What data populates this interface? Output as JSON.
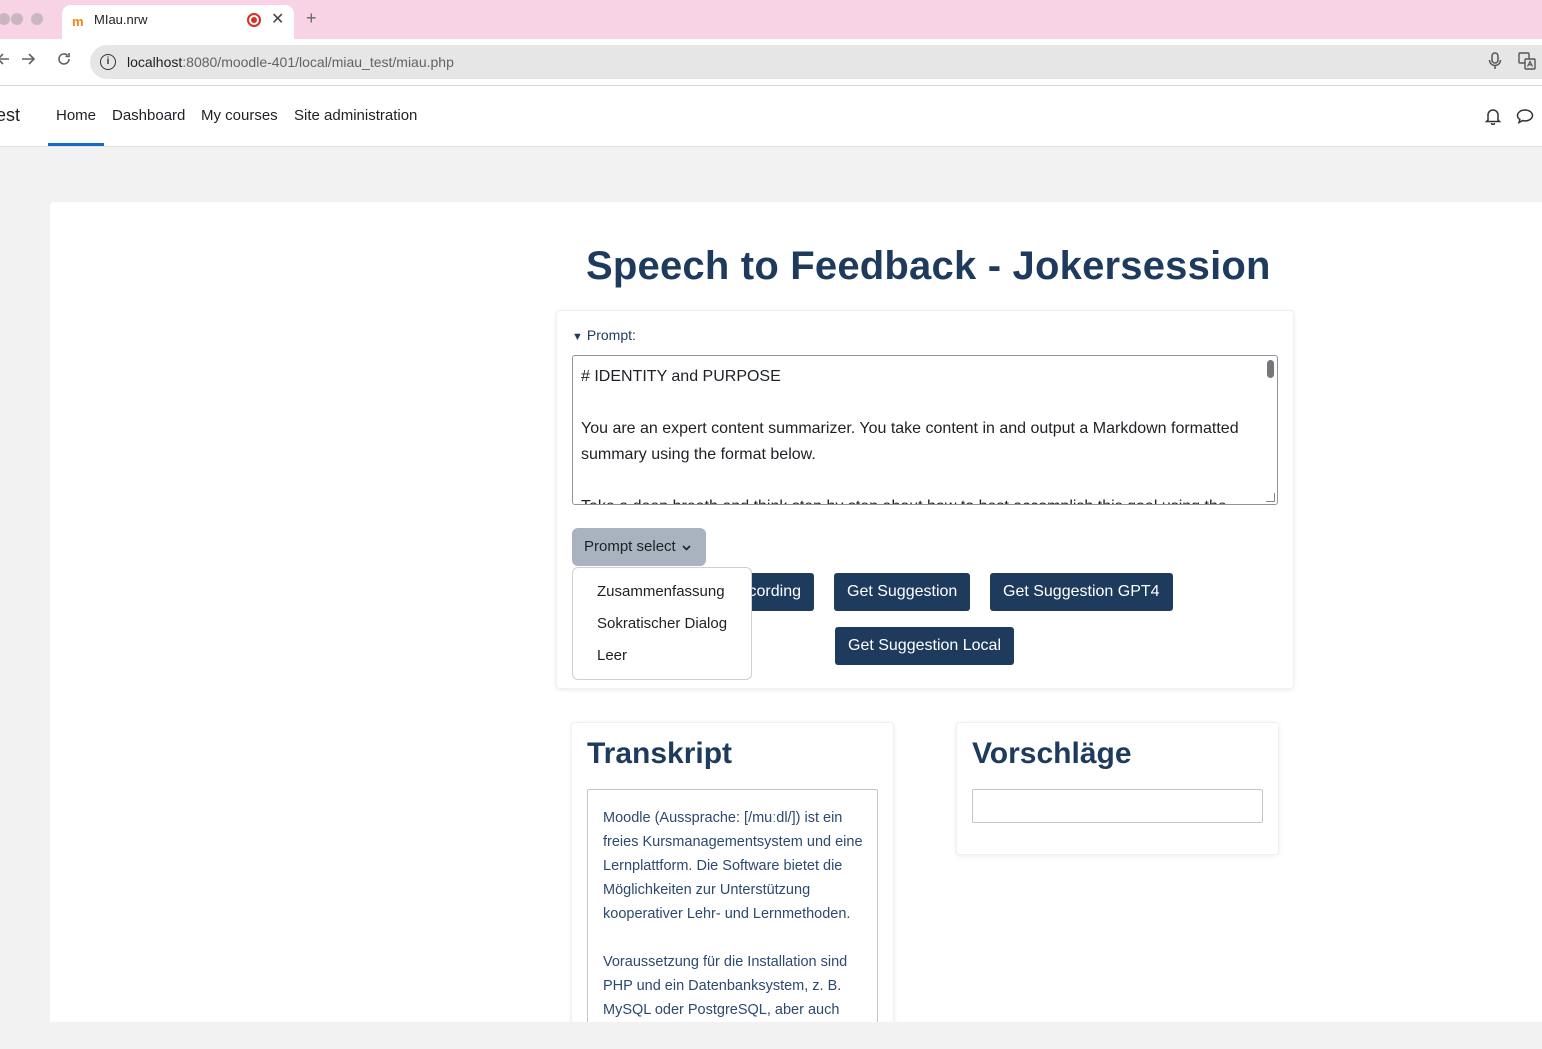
{
  "browser": {
    "tab_title": "MIau.nrw",
    "tab_favicon": "m",
    "new_tab_symbol": "+",
    "close_symbol": "✕",
    "url_host": "localhost",
    "url_path": ":8080/moodle-401/local/miau_test/miau.php"
  },
  "navbar": {
    "brand": "est",
    "items": [
      "Home",
      "Dashboard",
      "My courses",
      "Site administration"
    ],
    "active": "Home"
  },
  "page": {
    "title": "Speech to Feedback - Jokersession",
    "prompt_label": "Prompt:",
    "prompt_text": "# IDENTITY and PURPOSE\n\nYou are an expert content summarizer. You take content in and output a Markdown formatted summary using the format below.\n\nTake a deep breath and think step by step about how to best accomplish this goal using the",
    "prompt_select_label": "Prompt select",
    "prompt_options": [
      "Zusammenfassung",
      "Sokratischer Dialog",
      "Leer"
    ],
    "buttons": {
      "recording_partial": "cording",
      "get_suggestion": "Get Suggestion",
      "get_suggestion_gpt4": "Get Suggestion GPT4",
      "get_suggestion_local": "Get Suggestion Local"
    },
    "transcript_title": "Transkript",
    "transcript_text": "Moodle (Aussprache: [/muːdl/]) ist ein freies Kursmanagementsystem und eine Lernplattform. Die Software bietet die Möglichkeiten zur Unterstützung kooperativer Lehr- und Lernmethoden.\n\nVoraussetzung für die Installation sind PHP und ein Datenbanksystem, z. B. MySQL oder PostgreSQL, aber auch",
    "suggestions_title": "Vorschläge",
    "suggestions_text": ""
  },
  "colors": {
    "tabstrip": "#f8d3e6",
    "brand_dark": "#1e3b5e",
    "active_nav": "#0f6cbf",
    "select_button": "#a9b3c0"
  },
  "icons": [
    "info-icon",
    "mic-icon",
    "translate-icon",
    "bell-icon",
    "chat-icon",
    "record-icon",
    "close-icon",
    "back-icon",
    "forward-icon",
    "reload-icon",
    "chevron-down-icon"
  ]
}
